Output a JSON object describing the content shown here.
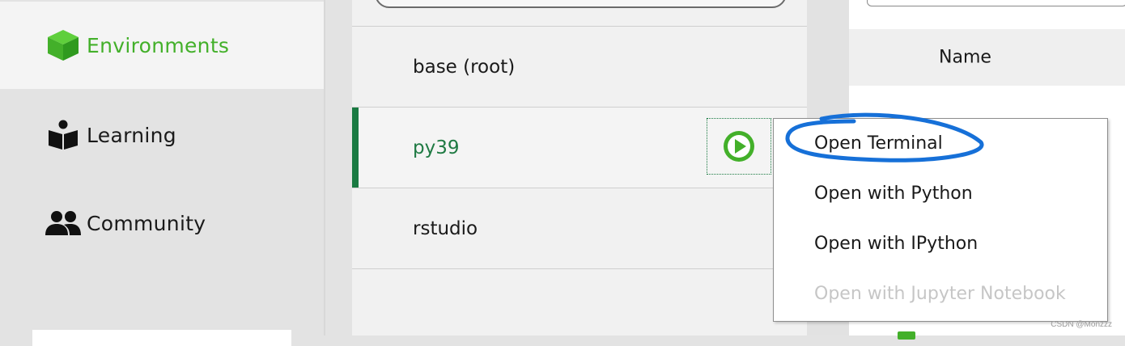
{
  "nav": {
    "items": [
      {
        "label": "Environments",
        "icon": "cube-icon",
        "active": true
      },
      {
        "label": "Learning",
        "icon": "book-reader-icon",
        "active": false
      },
      {
        "label": "Community",
        "icon": "people-icon",
        "active": false
      }
    ]
  },
  "environments": {
    "rows": [
      {
        "name": "base (root)"
      },
      {
        "name": "py39",
        "selected": true
      },
      {
        "name": "rstudio"
      }
    ]
  },
  "packages": {
    "header": {
      "name_col": "Name"
    }
  },
  "context_menu": {
    "items": [
      {
        "label": "Open Terminal",
        "enabled": true
      },
      {
        "label": "Open with Python",
        "enabled": true
      },
      {
        "label": "Open with IPython",
        "enabled": true
      },
      {
        "label": "Open with Jupyter Notebook",
        "enabled": false
      }
    ]
  },
  "watermark": "CSDN @Monzzz",
  "colors": {
    "accent_green": "#43b02a",
    "selected_green": "#1f7a43",
    "annotation_blue": "#1670d8"
  }
}
